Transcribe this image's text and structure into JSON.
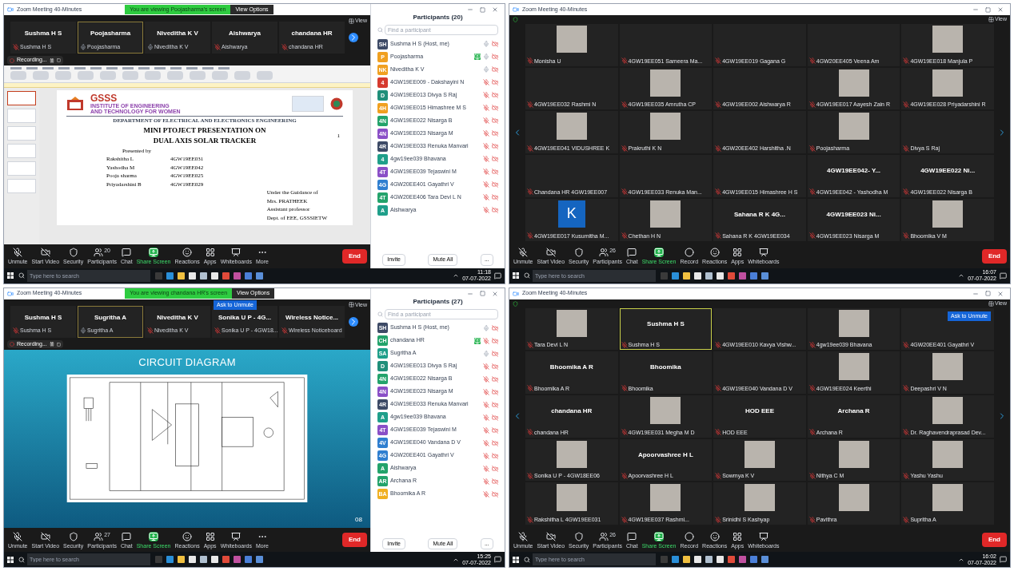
{
  "screens": [
    {
      "kind": "share",
      "title": "Zoom Meeting 40-Minutes",
      "banner": "You are viewing Poojasharma's screen",
      "view_options": "View Options",
      "view_label": "View",
      "recording": "Recording...",
      "strip": [
        {
          "name": "Sushma H S",
          "label": "Sushma H S",
          "muted": true,
          "selected": false
        },
        {
          "name": "Poojasharma",
          "label": "Poojasharma",
          "muted": false,
          "selected": true
        },
        {
          "name": "Niveditha K V",
          "label": "Niveditha K V",
          "muted": false,
          "selected": false
        },
        {
          "name": "Aishwarya",
          "label": "Aishwarya",
          "muted": true,
          "selected": false
        },
        {
          "name": "chandana HR",
          "label": "chandana HR",
          "muted": true,
          "selected": false
        }
      ],
      "content": {
        "kind": "slides_editor",
        "slide": {
          "page": "1",
          "institute": "GSSS",
          "institute_lines": [
            "INSTITUTE OF ENGINEERING",
            "AND TECHNOLOGY FOR WOMEN"
          ],
          "department": "DEPARTMENT OF ELECTRICAL AND ELECTRONICS ENGINEERING",
          "title_lines": [
            "MINI PTOJECT PRESENTATION ON",
            "DUAL AXIS SOLAR TRACKER"
          ],
          "presented_by": "Presented by",
          "presenters": [
            {
              "name": "Rakshitha L",
              "id": "4GW19EE031"
            },
            {
              "name": "Yashodha M",
              "id": "4GW19EE042"
            },
            {
              "name": "Pooja sharma",
              "id": "4GW19EE025"
            },
            {
              "name": "Priyadarshini B",
              "id": "4GW19EE029"
            }
          ],
          "guidance": [
            "Under the Guidance of",
            "Mrs. PRATHEEK",
            "Assistant professor",
            "Dept. of EEE, GSSSIETW"
          ]
        }
      },
      "toolbar": [
        {
          "kind": "mic",
          "label": "Unmute"
        },
        {
          "kind": "video",
          "label": "Start Video"
        },
        {
          "kind": "security",
          "label": "Security"
        },
        {
          "kind": "participants",
          "label": "Participants",
          "badge": "20"
        },
        {
          "kind": "chat",
          "label": "Chat"
        },
        {
          "kind": "share",
          "label": "Share Screen"
        },
        {
          "kind": "reactions",
          "label": "Reactions"
        },
        {
          "kind": "apps",
          "label": "Apps"
        },
        {
          "kind": "whiteboards",
          "label": "Whiteboards"
        },
        {
          "kind": "more",
          "label": "More"
        }
      ],
      "end": "End",
      "panel": {
        "title": "Participants (20)",
        "search_placeholder": "Find a participant",
        "invite": "Invite",
        "mute_all": "Mute All",
        "more": "...",
        "participants": [
          {
            "initials": "SH",
            "color": "#3d4a66",
            "name": "Sushma H S (Host, me)",
            "muted": false,
            "video": false,
            "sharing": false
          },
          {
            "initials": "P",
            "color": "#f0a020",
            "name": "Poojasharma",
            "muted": false,
            "video": false,
            "sharing": true
          },
          {
            "initials": "NK",
            "color": "#f0a020",
            "name": "Niveditha K V",
            "muted": false,
            "video": false,
            "sharing": false
          },
          {
            "initials": "4",
            "color": "#d63a2f",
            "name": "4GW19EE009 - Dakshayini N",
            "muted": true,
            "video": false,
            "sharing": false
          },
          {
            "initials": "D",
            "color": "#1f8f7a",
            "name": "4GW19EE013 Divya S Raj",
            "muted": true,
            "video": false,
            "sharing": false
          },
          {
            "initials": "4H",
            "color": "#f0a020",
            "name": "4GW19EE015 Himashree M S",
            "muted": true,
            "video": false,
            "sharing": false
          },
          {
            "initials": "4N",
            "color": "#23a36b",
            "name": "4GW19EE022 Nisarga B",
            "muted": true,
            "video": false,
            "sharing": false
          },
          {
            "initials": "4N",
            "color": "#8a4fc7",
            "name": "4GW19EE023 Nisarga M",
            "muted": true,
            "video": false,
            "sharing": false
          },
          {
            "initials": "4R",
            "color": "#3d4a66",
            "name": "4GW19EE033 Renuka Manvari",
            "muted": true,
            "video": false,
            "sharing": false
          },
          {
            "initials": "4",
            "color": "#1f9f8a",
            "name": "4gw19ee039 Bhavana",
            "muted": true,
            "video": false,
            "sharing": false
          },
          {
            "initials": "4T",
            "color": "#8a4fc7",
            "name": "4GW19EE039 Tejaswini M",
            "muted": true,
            "video": false,
            "sharing": false
          },
          {
            "initials": "4G",
            "color": "#2f7fd0",
            "name": "4GW20EE401 Gayathri V",
            "muted": true,
            "video": false,
            "sharing": false
          },
          {
            "initials": "4T",
            "color": "#23a36b",
            "name": "4GW20EE406 Tara Devi L N",
            "muted": true,
            "video": false,
            "sharing": false
          },
          {
            "initials": "A",
            "color": "#1f9f8a",
            "name": "Aishwarya",
            "muted": true,
            "video": false,
            "sharing": false
          }
        ]
      },
      "taskbar": {
        "search_placeholder": "Type here to search",
        "time": "11:18",
        "date": "07-07-2022"
      }
    },
    {
      "kind": "gallery",
      "title": "Zoom Meeting 40-Minutes",
      "view_label": "View",
      "tiles": [
        {
          "kind": "video",
          "label": "Monisha U",
          "muted": true,
          "selected": false
        },
        {
          "kind": "empty",
          "label": "4GW19EE051 Sameera Ma...",
          "muted": true,
          "selected": false
        },
        {
          "kind": "empty",
          "label": "4GW19EE019 Gagana G",
          "muted": true,
          "selected": false
        },
        {
          "kind": "empty",
          "label": "4GW20EE405 Veena Am",
          "muted": true,
          "selected": false
        },
        {
          "kind": "video",
          "label": "4GW19EE018 Manjula P",
          "muted": true,
          "selected": false
        },
        {
          "kind": "empty",
          "label": "4GW19EE032 Rashmi N",
          "muted": true,
          "selected": false
        },
        {
          "kind": "video",
          "label": "4GW19EE035 Amrutha CP",
          "muted": true,
          "selected": false
        },
        {
          "kind": "empty",
          "label": "4GW19EE002 Aishwarya R",
          "muted": true,
          "selected": false
        },
        {
          "kind": "video",
          "label": "4GW19EE017 Aayesh Zain R",
          "muted": true,
          "selected": false
        },
        {
          "kind": "video",
          "label": "4GW19EE028 Priyadarshini R",
          "muted": true,
          "selected": false
        },
        {
          "kind": "video",
          "label": "4GW19EE041 VIDUSHREE K",
          "muted": true,
          "selected": false
        },
        {
          "kind": "video",
          "label": "Prakruthi K N",
          "muted": true,
          "selected": false
        },
        {
          "kind": "empty",
          "label": "4GW20EE402 Harshitha .N",
          "muted": true,
          "selected": false
        },
        {
          "kind": "video",
          "label": "Poojasharma",
          "muted": true,
          "selected": false
        },
        {
          "kind": "empty",
          "label": "Divya S Raj",
          "muted": true,
          "selected": false
        },
        {
          "kind": "empty",
          "label": "Chandana HR 4GW19EE007",
          "muted": true,
          "selected": false
        },
        {
          "kind": "empty",
          "label": "4GW19EE033 Renuka Man...",
          "muted": true,
          "selected": false
        },
        {
          "kind": "empty",
          "label": "4GW19EE015 Himashree H S",
          "muted": true,
          "selected": false
        },
        {
          "kind": "name",
          "display": "4GW19EE042- Y...",
          "label": "4GW19EE042 - Yashodha M",
          "muted": true,
          "selected": false
        },
        {
          "kind": "name",
          "display": "4GW19EE022 Ni...",
          "label": "4GW19EE022 Nisarga B",
          "muted": true,
          "selected": false
        },
        {
          "kind": "avatar",
          "display": "K",
          "label": "4GW19EE017 Kusumitha M...",
          "muted": true,
          "selected": false
        },
        {
          "kind": "video",
          "label": "Chethan H N",
          "muted": true,
          "selected": false
        },
        {
          "kind": "name",
          "display": "Sahana R K 4G...",
          "label": "Sahana R K 4GW19EE034",
          "muted": true,
          "selected": false
        },
        {
          "kind": "name",
          "display": "4GW19EE023 Ni...",
          "label": "4GW19EE023 Nisarga M",
          "muted": true,
          "selected": false
        },
        {
          "kind": "video",
          "label": "Bhoomika V M",
          "muted": true,
          "selected": false
        }
      ],
      "toolbar": [
        {
          "kind": "mic",
          "label": "Unmute"
        },
        {
          "kind": "video",
          "label": "Start Video"
        },
        {
          "kind": "security",
          "label": "Security"
        },
        {
          "kind": "participants",
          "label": "Participants",
          "badge": "26"
        },
        {
          "kind": "chat",
          "label": "Chat"
        },
        {
          "kind": "share",
          "label": "Share Screen"
        },
        {
          "kind": "record",
          "label": "Record"
        },
        {
          "kind": "reactions",
          "label": "Reactions"
        },
        {
          "kind": "apps",
          "label": "Apps"
        },
        {
          "kind": "whiteboards",
          "label": "Whiteboards"
        }
      ],
      "end": "End",
      "taskbar": {
        "search_placeholder": "Type here to search",
        "time": "16:07",
        "date": "07-07-2022"
      }
    },
    {
      "kind": "share",
      "title": "Zoom Meeting 40-Minutes",
      "banner": "You are viewing chandana HR's screen",
      "view_options": "View Options",
      "view_label": "View",
      "recording": "Recording...",
      "ask_unmute": "Ask to Unmute",
      "strip": [
        {
          "name": "Sushma H S",
          "label": "Sushma H S",
          "muted": true,
          "selected": false
        },
        {
          "name": "Sugritha A",
          "label": "Sugritha A",
          "muted": false,
          "selected": true
        },
        {
          "name": "Niveditha K V",
          "label": "Niveditha K V",
          "muted": true,
          "selected": false
        },
        {
          "name": "Sonika U P - 4G...",
          "label": "Sonika U P - 4GW18...",
          "muted": true,
          "selected": false
        },
        {
          "name": "Wireless Notice...",
          "label": "Wireless Noticeboard",
          "muted": true,
          "selected": false
        }
      ],
      "content": {
        "kind": "slide_show",
        "slide": {
          "title": "CIRCUIT DIAGRAM",
          "page": "08"
        }
      },
      "toolbar": [
        {
          "kind": "mic",
          "label": "Unmute"
        },
        {
          "kind": "video",
          "label": "Start Video"
        },
        {
          "kind": "security",
          "label": "Security"
        },
        {
          "kind": "participants",
          "label": "Participants",
          "badge": "27"
        },
        {
          "kind": "chat",
          "label": "Chat"
        },
        {
          "kind": "share",
          "label": "Share Screen"
        },
        {
          "kind": "reactions",
          "label": "Reactions"
        },
        {
          "kind": "apps",
          "label": "Apps"
        },
        {
          "kind": "whiteboards",
          "label": "Whiteboards"
        },
        {
          "kind": "more",
          "label": "More"
        }
      ],
      "end": "End",
      "panel": {
        "title": "Participants (27)",
        "search_placeholder": "Find a participant",
        "invite": "Invite",
        "mute_all": "Mute All",
        "more": "...",
        "participants": [
          {
            "initials": "SH",
            "color": "#3d4a66",
            "name": "Sushma H S (Host, me)",
            "muted": false,
            "video": false,
            "sharing": false
          },
          {
            "initials": "CH",
            "color": "#23a36b",
            "name": "chandana HR",
            "muted": true,
            "video": false,
            "sharing": true
          },
          {
            "initials": "SA",
            "color": "#1f9f8a",
            "name": "Sugritha A",
            "muted": false,
            "video": false,
            "sharing": false
          },
          {
            "initials": "D",
            "color": "#1f8f7a",
            "name": "4GW19EE013 Divya S Raj",
            "muted": true,
            "video": false,
            "sharing": false
          },
          {
            "initials": "4N",
            "color": "#23a36b",
            "name": "4GW19EE022 Nisarga B",
            "muted": true,
            "video": false,
            "sharing": false
          },
          {
            "initials": "4N",
            "color": "#8a4fc7",
            "name": "4GW19EE023 Nisarga M",
            "muted": true,
            "video": false,
            "sharing": false
          },
          {
            "initials": "4R",
            "color": "#3d4a66",
            "name": "4GW19EE033 Renuka Manvari",
            "muted": true,
            "video": false,
            "sharing": false
          },
          {
            "initials": "A",
            "color": "#1f9f8a",
            "name": "4gw19ee039 Bhavana",
            "muted": true,
            "video": false,
            "sharing": false
          },
          {
            "initials": "4T",
            "color": "#8a4fc7",
            "name": "4GW19EE039 Tejaswini M",
            "muted": true,
            "video": false,
            "sharing": false
          },
          {
            "initials": "4V",
            "color": "#2f7fd0",
            "name": "4GW19EE040 Vandana D V",
            "muted": true,
            "video": false,
            "sharing": false
          },
          {
            "initials": "4G",
            "color": "#2f7fd0",
            "name": "4GW20EE401 Gayathri V",
            "muted": true,
            "video": false,
            "sharing": false
          },
          {
            "initials": "A",
            "color": "#23a36b",
            "name": "Aishwarya",
            "muted": true,
            "video": false,
            "sharing": false
          },
          {
            "initials": "AR",
            "color": "#23a36b",
            "name": "Archana R",
            "muted": true,
            "video": false,
            "sharing": false
          },
          {
            "initials": "BA",
            "color": "#f0b020",
            "name": "Bhoomika A R",
            "muted": true,
            "video": false,
            "sharing": false
          }
        ]
      },
      "taskbar": {
        "search_placeholder": "Type here to search",
        "time": "15:25",
        "date": "07-07-2022"
      }
    },
    {
      "kind": "gallery",
      "title": "Zoom Meeting 40-Minutes",
      "view_label": "View",
      "tiles": [
        {
          "kind": "video",
          "label": "Tara Devi L N",
          "muted": true,
          "selected": false
        },
        {
          "kind": "name",
          "display": "Sushma H S",
          "label": "Sushma H S",
          "muted": true,
          "selected": true
        },
        {
          "kind": "empty",
          "label": "4GW19EE010 Kavya Vishw...",
          "muted": true,
          "selected": false
        },
        {
          "kind": "video",
          "label": "4gw19ee039 Bhavana",
          "muted": true,
          "selected": false
        },
        {
          "kind": "empty",
          "label": "4GW20EE401 Gayathri V",
          "muted": true,
          "selected": false,
          "ask_unmute": "Ask to Unmute"
        },
        {
          "kind": "name",
          "display": "Bhoomika A R",
          "label": "Bhoomika A R",
          "muted": true,
          "selected": false
        },
        {
          "kind": "name",
          "display": "Bhoomika",
          "label": "Bhoomika",
          "muted": true,
          "selected": false
        },
        {
          "kind": "empty",
          "label": "4GW19EE040 Vandana D V",
          "muted": true,
          "selected": false
        },
        {
          "kind": "video",
          "label": "4GW19EE024 Keerthi",
          "muted": true,
          "selected": false
        },
        {
          "kind": "video",
          "label": "Deepashri V N",
          "muted": true,
          "selected": false
        },
        {
          "kind": "name",
          "display": "chandana HR",
          "label": "chandana HR",
          "muted": true,
          "selected": false
        },
        {
          "kind": "video",
          "label": "4GW19EE031 Megha M D",
          "muted": true,
          "selected": false
        },
        {
          "kind": "name",
          "display": "HOD EEE",
          "label": "HOD EEE",
          "muted": true,
          "selected": false
        },
        {
          "kind": "name",
          "display": "Archana R",
          "label": "Archana R",
          "muted": true,
          "selected": false
        },
        {
          "kind": "video",
          "label": "Dr. Raghavendraprasad Dev...",
          "muted": true,
          "selected": false
        },
        {
          "kind": "video",
          "label": "Sonika U P - 4GW18EE06",
          "muted": true,
          "selected": false
        },
        {
          "kind": "name",
          "display": "Apoorvashree H L",
          "label": "Apoorvashree H L",
          "muted": true,
          "selected": false
        },
        {
          "kind": "video",
          "label": "Sowmya K V",
          "muted": true,
          "selected": false
        },
        {
          "kind": "video",
          "label": "Nithya C M",
          "muted": true,
          "selected": false
        },
        {
          "kind": "video",
          "label": "Yashu Yashu",
          "muted": true,
          "selected": false
        },
        {
          "kind": "video",
          "label": "Rakshitha L 4GW19EE031",
          "muted": true,
          "selected": false
        },
        {
          "kind": "video",
          "label": "4GW19EE037 Rashmi...",
          "muted": true,
          "selected": false
        },
        {
          "kind": "video",
          "label": "Srinidhi S Kashyap",
          "muted": true,
          "selected": false
        },
        {
          "kind": "video",
          "label": "Pavithra",
          "muted": true,
          "selected": false
        },
        {
          "kind": "video",
          "label": "Supritha A",
          "muted": true,
          "selected": false
        }
      ],
      "toolbar": [
        {
          "kind": "mic",
          "label": "Unmute"
        },
        {
          "kind": "video",
          "label": "Start Video"
        },
        {
          "kind": "security",
          "label": "Security"
        },
        {
          "kind": "participants",
          "label": "Participants",
          "badge": "26"
        },
        {
          "kind": "chat",
          "label": "Chat"
        },
        {
          "kind": "share",
          "label": "Share Screen"
        },
        {
          "kind": "record",
          "label": "Record"
        },
        {
          "kind": "reactions",
          "label": "Reactions"
        },
        {
          "kind": "apps",
          "label": "Apps"
        },
        {
          "kind": "whiteboards",
          "label": "Whiteboards"
        }
      ],
      "end": "End",
      "taskbar": {
        "search_placeholder": "Type here to search",
        "time": "16:02",
        "date": "07-07-2022"
      }
    }
  ]
}
